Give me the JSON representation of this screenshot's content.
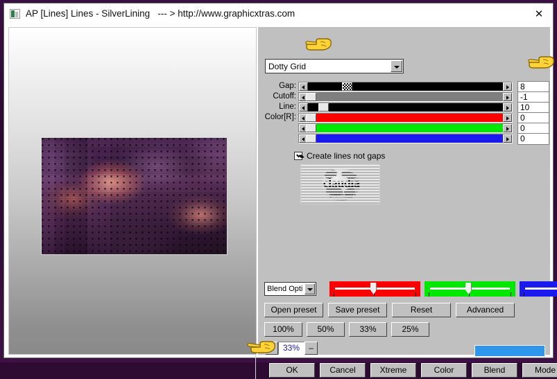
{
  "window": {
    "title_app": "AP [Lines]  Lines - SilverLining",
    "title_sep": "--- >",
    "title_url": "http://www.graphicxtras.com",
    "close_glyph": "✕",
    "app_icon": "plugin-icon"
  },
  "effect": {
    "preset_label": "Dotty Grid",
    "combo_arrow": "chevron-down-icon"
  },
  "sliders": [
    {
      "label": "Gap:",
      "value": "8"
    },
    {
      "label": "Cutoff:",
      "value": "-1"
    },
    {
      "label": "Line:",
      "value": "10"
    },
    {
      "label": "Color[R]:",
      "value": "0"
    },
    {
      "label": "",
      "value": "0"
    },
    {
      "label": "",
      "value": "0"
    }
  ],
  "checkbox": {
    "label": "Create lines not gaps",
    "checked": true
  },
  "thumbnail": {
    "brand": "claudia",
    "subtext": "graphicxtras"
  },
  "blend": {
    "combo_label": "Blend Opti",
    "channels": [
      "red",
      "green",
      "blue"
    ],
    "colors": {
      "red": "#ff0000",
      "green": "#00e800",
      "blue": "#1a1aee"
    }
  },
  "preset_buttons": [
    {
      "label": "Open preset"
    },
    {
      "label": "Save preset"
    },
    {
      "label": "Reset"
    },
    {
      "label": "Advanced"
    }
  ],
  "zoom_buttons": [
    {
      "label": "100%"
    },
    {
      "label": "50%"
    },
    {
      "label": "33%"
    },
    {
      "label": "25%"
    }
  ],
  "zoom_spinner": {
    "increase": "+",
    "value": "33%",
    "decrease": "–"
  },
  "swatch": {
    "color": "#2e97ec"
  },
  "action_buttons": [
    {
      "label": "OK"
    },
    {
      "label": "Cancel"
    },
    {
      "label": "Xtreme"
    },
    {
      "label": "Color"
    },
    {
      "label": "Blend"
    },
    {
      "label": "Mode"
    }
  ]
}
